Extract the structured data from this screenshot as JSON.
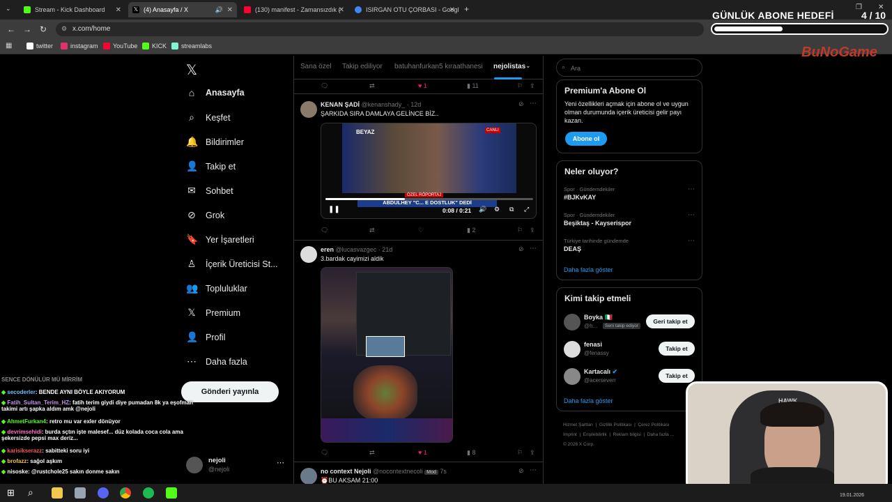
{
  "browser": {
    "tabs": [
      {
        "title": "Stream - Kick Dashboard",
        "color": "#53fc18"
      },
      {
        "title": "(4) Anasayfa / X",
        "color": "#ffffff"
      },
      {
        "title": "(130) manifest - Zamansızdık (",
        "color": "#ff0033"
      },
      {
        "title": "ISIRGAN OTU ÇORBASI - Googl",
        "color": "#4285f4"
      }
    ],
    "url": "x.com/home",
    "bookmarks": [
      {
        "label": "twitter",
        "color": "#ffffff"
      },
      {
        "label": "instagram",
        "color": "#e1306c"
      },
      {
        "label": "YouTube",
        "color": "#ff0033"
      },
      {
        "label": "KICK",
        "color": "#53fc18"
      },
      {
        "label": "streamlabs",
        "color": "#80f5d2"
      }
    ]
  },
  "overlay": {
    "goal_title": "GÜNLÜK ABONE HEDEFİ",
    "goal_count": "4 / 10",
    "goal_progress": 0.4,
    "brand": "BuNoGame"
  },
  "leftnav": {
    "items": [
      {
        "label": "Anasayfa",
        "icon": "home-icon",
        "glyph": "⌂"
      },
      {
        "label": "Keşfet",
        "icon": "search-icon",
        "glyph": "⌕"
      },
      {
        "label": "Bildirimler",
        "icon": "bell-icon",
        "glyph": "🔔"
      },
      {
        "label": "Takip et",
        "icon": "add-user-icon",
        "glyph": "👤"
      },
      {
        "label": "Sohbet",
        "icon": "mail-icon",
        "glyph": "✉"
      },
      {
        "label": "Grok",
        "icon": "grok-icon",
        "glyph": "⊘"
      },
      {
        "label": "Yer İşaretleri",
        "icon": "bookmark-icon",
        "glyph": "🔖"
      },
      {
        "label": "İçerik Üreticisi St...",
        "icon": "creator-icon",
        "glyph": "♙"
      },
      {
        "label": "Topluluklar",
        "icon": "communities-icon",
        "glyph": "👥"
      },
      {
        "label": "Premium",
        "icon": "x-premium-icon",
        "glyph": "𝕏"
      },
      {
        "label": "Profil",
        "icon": "profile-icon",
        "glyph": "👤"
      },
      {
        "label": "Daha fazla",
        "icon": "more-icon",
        "glyph": "⋯"
      }
    ],
    "post_button": "Gönderi yayınla",
    "profile_name": "nejoli",
    "profile_handle": "@nejoli"
  },
  "feed": {
    "tabs": [
      "Sana özel",
      "Takip ediliyor",
      "batuhanfurkan5 kıraathanesi",
      "nejolistas"
    ],
    "top_actions": {
      "likes": "1",
      "views": "11"
    },
    "posts": [
      {
        "name": "KENAN ŞADİ",
        "handle": "@kenanshady_ · 12d",
        "text": "ŞARKIDA SIRA DAMLAYA GELİNCE BİZ..",
        "video_time": "0:08 / 0:21",
        "video_caption": "ABDULHEY \"C... E DOSTLUK\" DEDİ",
        "video_badge": "ÖZEL RÖPORTAJ",
        "views": "2"
      },
      {
        "name": "eren",
        "handle": "@lucasvazgec · 21d",
        "text": "3.bardak cayimizi aldik",
        "likes": "1",
        "views": "8"
      },
      {
        "name": "no context Nejoli",
        "handle": "@nocontextnecoli",
        "badge": "Mod",
        "time": "7s",
        "text": "⏰BU AKSAM 21:00"
      }
    ]
  },
  "right": {
    "search_placeholder": "Ara",
    "premium": {
      "title": "Premium'a Abone Ol",
      "body": "Yeni özellikleri açmak için abone ol ve uygun olman durumunda içerik üreticisi gelir payı kazan.",
      "button": "Abone ol"
    },
    "trends_title": "Neler oluyor?",
    "trends": [
      {
        "category": "Spor · Gündemdekiler",
        "name": "#BJKvKAY"
      },
      {
        "category": "Spor · Gündemdekiler",
        "name": "Beşiktaş - Kayserispor"
      },
      {
        "category": "Türkiye tarihinde gündemde",
        "name": "DEAŞ"
      }
    ],
    "show_more": "Daha fazla göster",
    "who_title": "Kimi takip etmeli",
    "who": [
      {
        "name": "Boyka 🇮🇹",
        "handle": "@h...",
        "extra": "Seni takip ediyor",
        "button": "Geri takip et"
      },
      {
        "name": "fenasi",
        "handle": "@fenassy",
        "extra": "",
        "button": "Takip et"
      },
      {
        "name": "Kartacalı",
        "handle": "@acerseverr",
        "extra": "",
        "button": "Takip et"
      }
    ],
    "who_more": "Daha fazla göster",
    "footer": [
      "Hizmet Şartları",
      "Gizlilik Politikası",
      "Çerez Politikası",
      "Imprint",
      "Erişilebilirlik",
      "Reklam bilgisi",
      "Daha fazla ...",
      "© 2026 X Corp."
    ]
  },
  "chat": [
    {
      "user": "",
      "text": "SENCE DÖNÜLÜR MÜ MİRRİM",
      "color": "#888888"
    },
    {
      "user": "secoderler",
      "text": ": BENDE AYNI BÖYLE AKIYORUM",
      "color": "#6ec1ff"
    },
    {
      "user": "Fatih_Sultan_Terim_HZ",
      "text": ": fatih terim giydi diye pumadan 8k ya eşofman takimi artı şapka aldım amk @nejoli",
      "color": "#c792ea"
    },
    {
      "user": "AhmetFurkan4",
      "text": ": retro mu var exler dönüyor",
      "color": "#53fc18"
    },
    {
      "user": "devrimsehidi",
      "text": ": burda sçtın işte malesef... düz kolada coca cola ama şekersizde pepsi max deriz...",
      "color": "#ff6ec7"
    },
    {
      "user": "karisikserazz",
      "text": ": sabitteki soru iyi",
      "color": "#ff5555"
    },
    {
      "user": "brofazz",
      "text": ": sağol aşkım",
      "color": "#f4c542"
    },
    {
      "user": "nisoske",
      "text": ": @rustchole25 sakın donme sakın",
      "color": "#ffffff"
    }
  ],
  "taskbar": {
    "date": "19.01.2026"
  }
}
